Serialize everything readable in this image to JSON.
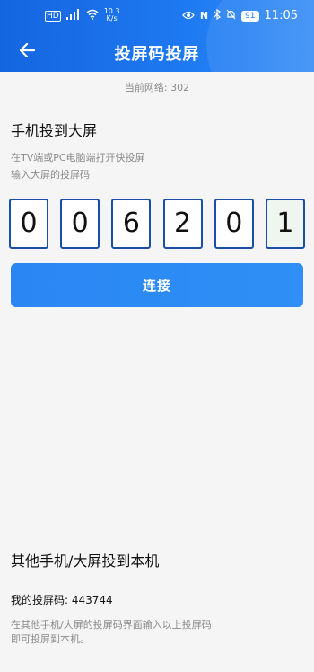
{
  "status_bar": {
    "network_label": "HD",
    "speed_value": "10.3",
    "speed_unit": "K/s",
    "nfc_label": "N",
    "battery": "91",
    "time": "11:05"
  },
  "header": {
    "title": "投屏码投屏"
  },
  "network": {
    "text": "当前网络: 302"
  },
  "phone_to_screen": {
    "title": "手机投到大屏",
    "hint_line1": "在TV端或PC电脑端打开快投屏",
    "hint_line2": "输入大屏的投屏码",
    "code_digits": [
      "0",
      "0",
      "6",
      "2",
      "0",
      "1"
    ],
    "connect_label": "连接"
  },
  "screen_to_phone": {
    "title": "其他手机/大屏投到本机",
    "my_code": "我的投屏码: 443744",
    "hint_line1": "在其他手机/大屏的投屏码界面输入以上投屏码",
    "hint_line2": "即可投屏到本机。"
  },
  "colors": {
    "header_blue": "#1e7af2",
    "button_blue": "#2a86f3",
    "box_border": "#1a4fa8"
  }
}
